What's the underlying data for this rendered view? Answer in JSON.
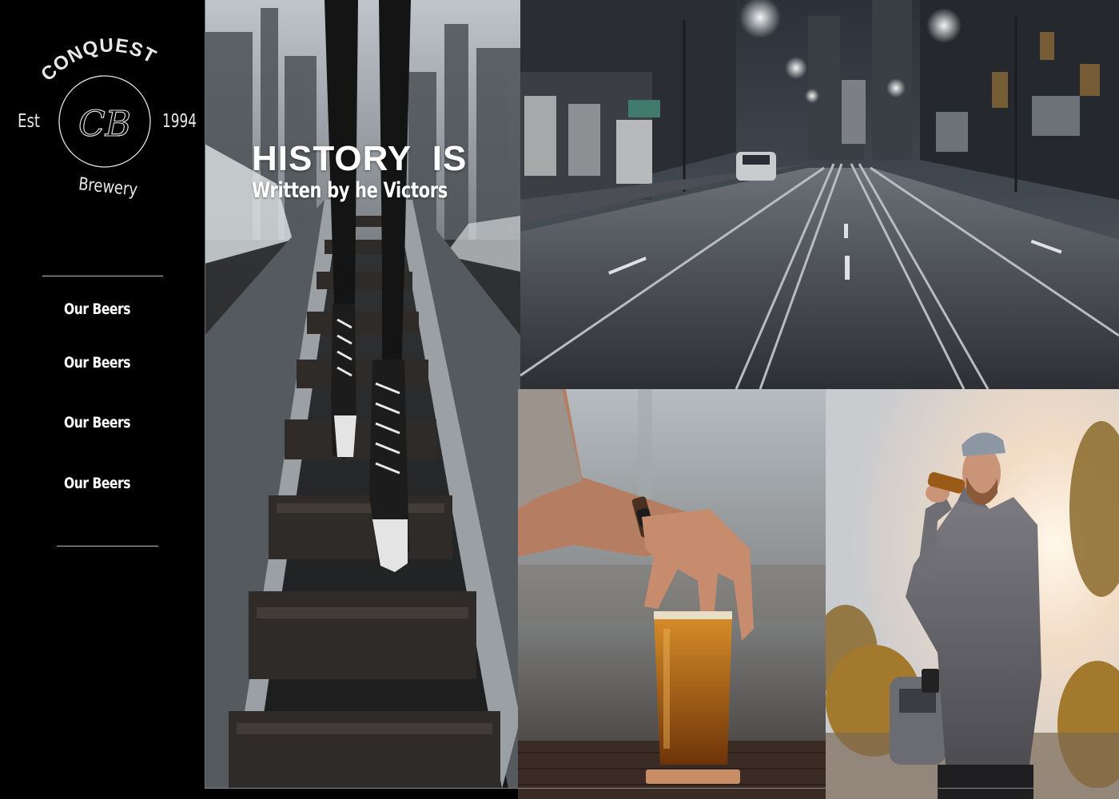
{
  "brand": {
    "arc_text": "CONQUEST",
    "monogram": "CB",
    "est_label": "Est",
    "year": "1994",
    "subtitle": "Brewery"
  },
  "nav": {
    "items": [
      {
        "label": "Our Beers"
      },
      {
        "label": "Our Beers"
      },
      {
        "label": "Our Beers"
      },
      {
        "label": "Our Beers"
      }
    ]
  },
  "hero": {
    "title": "HISTORY  IS",
    "subtitle": "Written by he Victors"
  },
  "images": {
    "tracks": "sneakers-walking-on-railway-tracks",
    "street": "night-city-street-with-tram-tracks",
    "glass": "hand-holding-glass-of-beer",
    "man": "man-drinking-beer-at-sunset"
  },
  "colors": {
    "sidebar_bg": "#000000",
    "text": "#ffffff",
    "divider": "#bdbdbd"
  }
}
